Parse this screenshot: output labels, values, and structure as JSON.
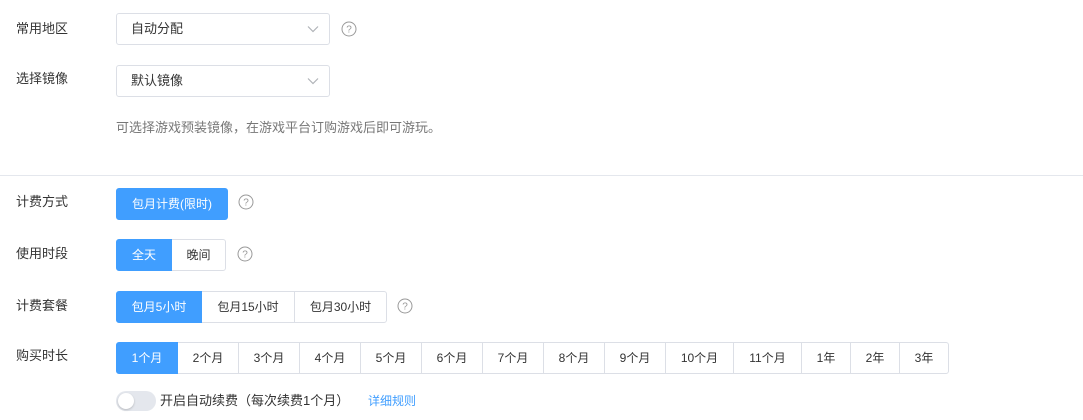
{
  "region": {
    "label": "常用地区",
    "value": "自动分配"
  },
  "image": {
    "label": "选择镜像",
    "value": "默认镜像",
    "hint": "可选择游戏预装镜像，在游戏平台订购游戏后即可游玩。"
  },
  "billing": {
    "label": "计费方式",
    "options": [
      "包月计费(限时)"
    ],
    "selected": "包月计费(限时)"
  },
  "period": {
    "label": "使用时段",
    "options": [
      "全天",
      "晚间"
    ],
    "selected": "全天"
  },
  "package": {
    "label": "计费套餐",
    "options": [
      "包月5小时",
      "包月15小时",
      "包月30小时"
    ],
    "selected": "包月5小时"
  },
  "duration": {
    "label": "购买时长",
    "options": [
      "1个月",
      "2个月",
      "3个月",
      "4个月",
      "5个月",
      "6个月",
      "7个月",
      "8个月",
      "9个月",
      "10个月",
      "11个月",
      "1年",
      "2年",
      "3年"
    ],
    "selected": "1个月"
  },
  "auto_renew": {
    "label": "开启自动续费（每次续费1个月）",
    "enabled": false,
    "link": "详细规则"
  },
  "colors": {
    "accent": "#409eff",
    "border": "#dcdfe6",
    "hint": "#777777"
  }
}
